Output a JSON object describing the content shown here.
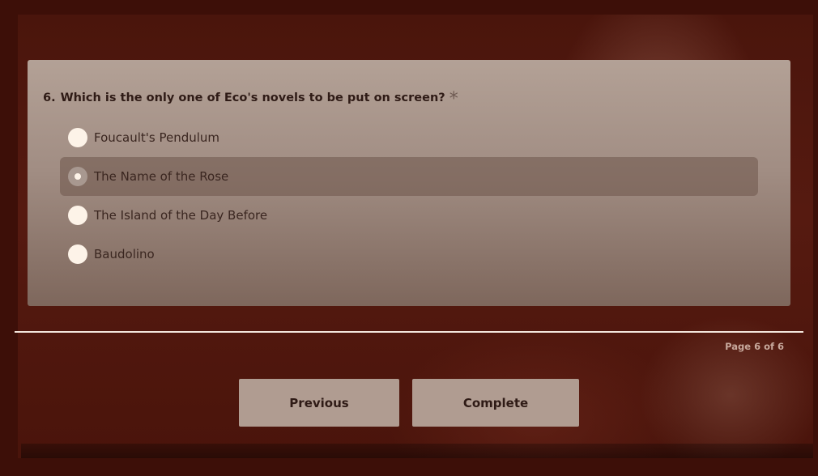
{
  "question": {
    "number": "6.",
    "text": "Which is the only one of Eco's novels to be put on screen?",
    "required_mark": "*",
    "options": [
      {
        "label": "Foucault's Pendulum",
        "selected": false
      },
      {
        "label": "The Name of the Rose",
        "selected": true
      },
      {
        "label": "The Island of the Day Before",
        "selected": false
      },
      {
        "label": "Baudolino",
        "selected": false
      }
    ]
  },
  "pagination": {
    "indicator": "Page 6 of 6"
  },
  "navigation": {
    "previous_label": "Previous",
    "complete_label": "Complete"
  },
  "colors": {
    "page_background": "#3d0f08",
    "card_background": "#a18d83",
    "button_background": "#b09c91",
    "radio_fill": "#fdf3e8"
  },
  "icons": {
    "radio_unselected": "radio-empty-icon",
    "radio_selected": "radio-checked-icon"
  }
}
